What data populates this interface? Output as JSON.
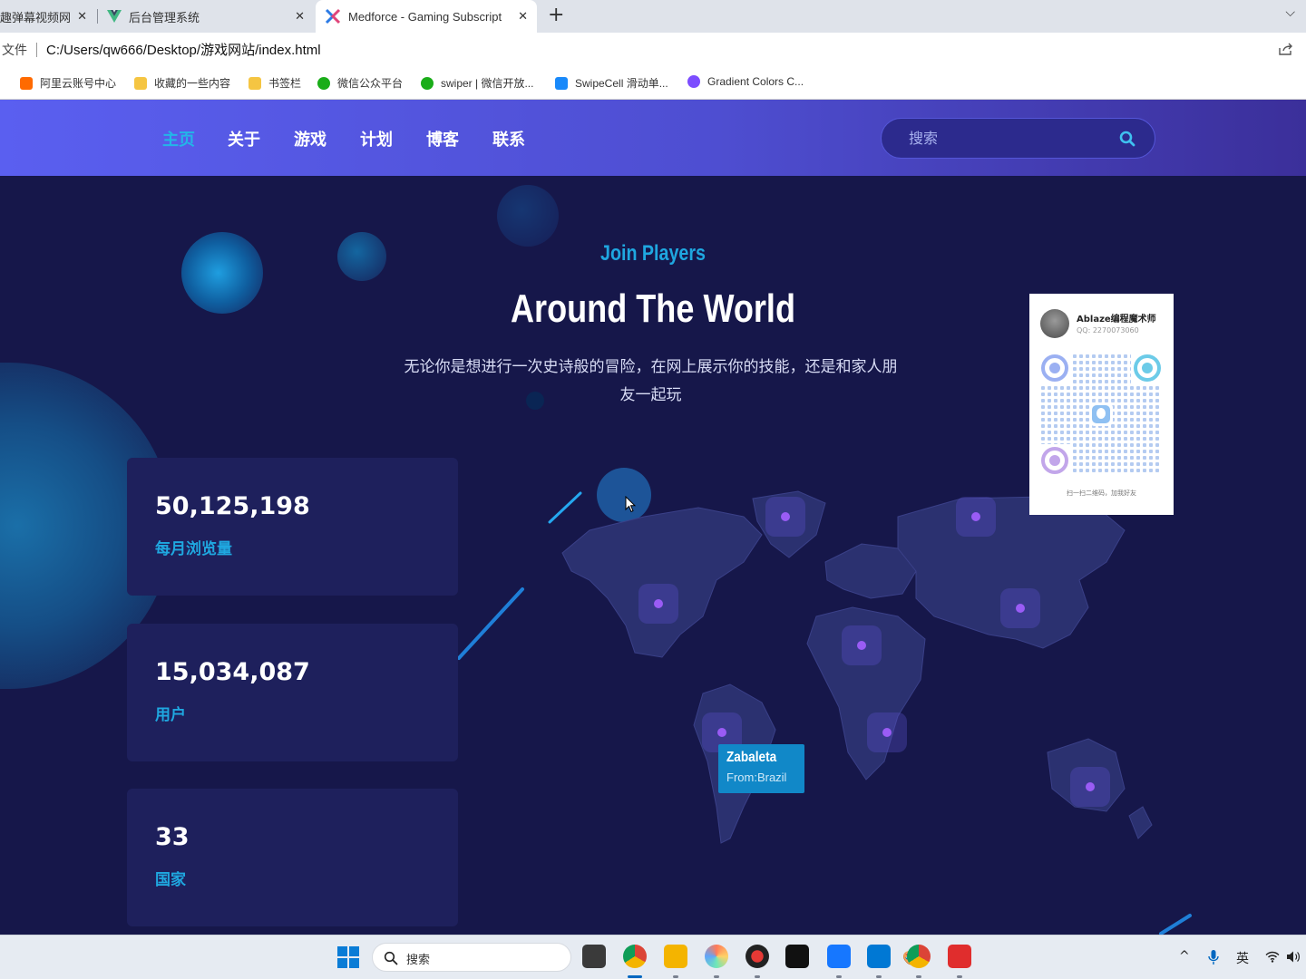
{
  "browser": {
    "tabs": [
      {
        "title": "趣弹幕视频网"
      },
      {
        "title": "后台管理系统"
      },
      {
        "title": "Medforce - Gaming Subscription"
      }
    ],
    "close_glyph": "✕",
    "new_tab_glyph": "+",
    "tab_menu_glyph": "⌵",
    "address_label": "文件",
    "url": "C:/Users/qw666/Desktop/游戏网站/index.html",
    "bookmarks": [
      {
        "label": "阿里云账号中心",
        "color": "#ff6a00"
      },
      {
        "label": "收藏的一些内容",
        "color": "#f5c542"
      },
      {
        "label": "书签栏",
        "color": "#f5c542"
      },
      {
        "label": "微信公众平台",
        "color": "#1aad19"
      },
      {
        "label": "swiper | 微信开放...",
        "color": "#1aad19"
      },
      {
        "label": "SwipeCell 滑动单...",
        "color": "#1989fa"
      },
      {
        "label": "Gradient Colors C...",
        "color": "#7c4dff"
      }
    ]
  },
  "site": {
    "nav": {
      "items": [
        "主页",
        "关于",
        "游戏",
        "计划",
        "博客",
        "联系"
      ],
      "active_index": 0,
      "search_placeholder": "搜索"
    },
    "hero": {
      "subtitle": "Join Players",
      "title": "Around The World",
      "description": "无论你是想进行一次史诗般的冒险，在网上展示你的技能，还是和家人朋友一起玩"
    },
    "stats": [
      {
        "value": "50,125,198",
        "label": "每月浏览量"
      },
      {
        "value": "15,034,087",
        "label": "用户"
      },
      {
        "value": "33",
        "label": "国家"
      }
    ],
    "map_tooltip": {
      "name": "Zabaleta",
      "from": "From:Brazil"
    },
    "qr_card": {
      "name": "Ablaze编程魔术师",
      "id": "QQ: 2270073060",
      "tip": "扫一扫二维码，加我好友"
    },
    "colors": {
      "accent": "#1fa7e0",
      "background": "#16174a",
      "card": "#1e205c",
      "pin": "#9a5cf5"
    }
  },
  "taskbar": {
    "search_label": "搜索",
    "apps": [
      {
        "name": "task-view",
        "color": "#3a3a3a"
      },
      {
        "name": "chrome",
        "color": "#4285f4"
      },
      {
        "name": "file-explorer",
        "color": "#f4b400"
      },
      {
        "name": "app-colorful",
        "color": "#ffb347"
      },
      {
        "name": "screen-recorder",
        "color": "#222222"
      },
      {
        "name": "capcut",
        "color": "#111111"
      },
      {
        "name": "app-blue-star",
        "color": "#1677ff"
      },
      {
        "name": "vscode",
        "color": "#0078d4"
      },
      {
        "name": "chrome-2",
        "color": "#4285f4"
      },
      {
        "name": "youdao",
        "color": "#e02d2d"
      }
    ],
    "tray": {
      "chevron": "^",
      "ime": "英"
    }
  }
}
